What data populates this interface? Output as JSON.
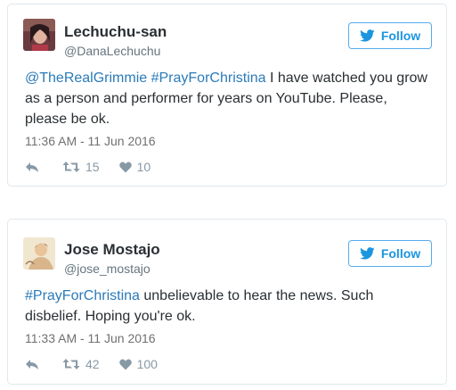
{
  "follow_label": "Follow",
  "colors": {
    "link": "#2b7bb9",
    "follow": "#1b95e0",
    "action": "#8899a6"
  },
  "tweets": [
    {
      "name": "Lechuchu-san",
      "handle": "@DanaLechuchu",
      "mention": "@TheRealGrimmie",
      "hashtag": "#PrayForChristina",
      "body": " I have watched you grow as a person and performer for years on YouTube. Please, please be ok.",
      "timestamp": "11:36 AM - 11 Jun 2016",
      "retweets": "15",
      "likes": "10",
      "icons": [
        "avatar-photo",
        "bird-icon",
        "reply-icon",
        "retweet-icon",
        "heart-icon"
      ]
    },
    {
      "name": "Jose Mostajo",
      "handle": "@jose_mostajo",
      "hashtag": "#PrayForChristina",
      "body": " unbelievable to hear the news. Such disbelief. Hoping you're ok.",
      "timestamp": "11:33 AM - 11 Jun 2016",
      "retweets": "42",
      "likes": "100",
      "icons": [
        "avatar-drawing",
        "bird-icon",
        "reply-icon",
        "retweet-icon",
        "heart-icon"
      ]
    }
  ]
}
